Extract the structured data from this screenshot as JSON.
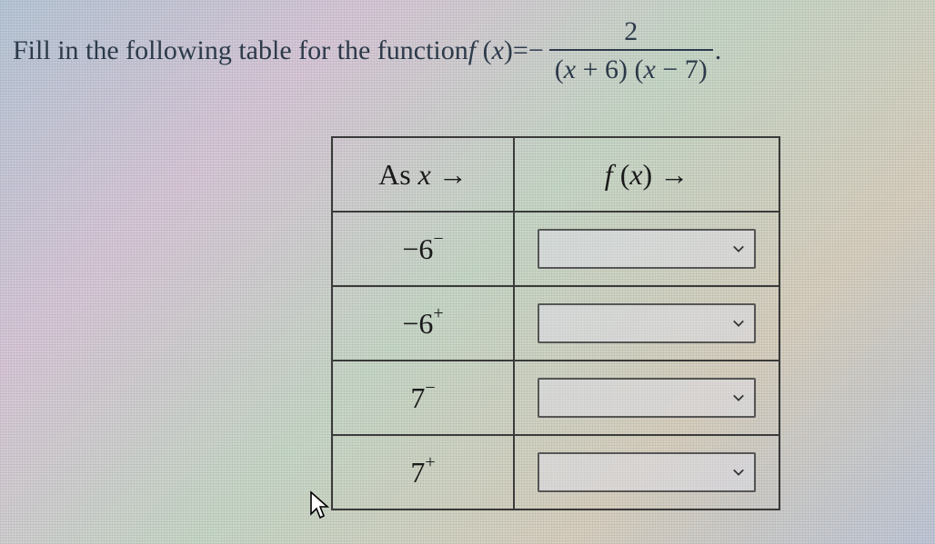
{
  "prompt": {
    "lead": "Fill in the following table for the function ",
    "fn_name": "f",
    "fn_arg": "x",
    "equals": " = ",
    "negative": "−",
    "numerator": "2",
    "den_left": "(",
    "den_x1": "x",
    "den_plus": " + 6) (",
    "den_x2": "x",
    "den_minus": " − 7)",
    "period": "."
  },
  "table": {
    "header_x_pre": "As ",
    "header_x_var": "x",
    "header_x_arrow": " →",
    "header_f_fn": "f",
    "header_f_open": " (",
    "header_f_arg": "x",
    "header_f_close": ") →",
    "rows": [
      {
        "base": "−6",
        "sup": "−"
      },
      {
        "base": "−6",
        "sup": "+"
      },
      {
        "base": "7",
        "sup": "−"
      },
      {
        "base": "7",
        "sup": "+"
      }
    ]
  }
}
